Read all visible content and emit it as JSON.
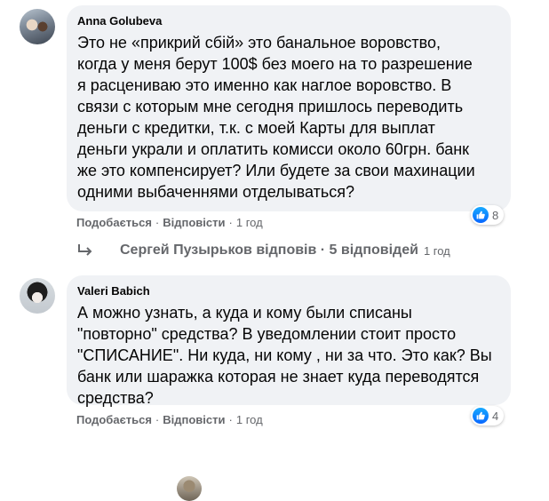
{
  "comments": [
    {
      "author": "Anna Golubeva",
      "text": "Это не «прикрий сбій» это банальное воровство,\nкогда у меня берут 100$ без моего на то разрешение\nя расцениваю это именно как наглое воровство. В\nсвязи с которым мне сегодня пришлось переводить\nденьги с кредитки, т.к. с моей Карты для выплат\nденьги украли и оплатить комисси около 60грн. банк\nже это компенсирует? Или будете за свои махинации\nодними выбаченнями отделываться?",
      "like_label": "Подобається",
      "reply_label": "Відповісти",
      "time": "1 год",
      "reaction_count": "8"
    },
    {
      "author": "Valeri Babich",
      "text": "А можно узнать, а куда и кому были списаны\n\"повторно\" средства? В уведомлении стоит просто\n\"СПИСАНИЕ\". Ни куда, ни кому , ни за что. Это как? Вы\nбанк или шаражка которая не знает куда переводятся\nсредства?",
      "like_label": "Подобається",
      "reply_label": "Відповісти",
      "time": "1 год",
      "reaction_count": "4"
    }
  ],
  "replies_row": {
    "text": "Сергей Пузырьков відповів · 5 відповідей",
    "time": "1 год"
  },
  "colors": {
    "bubble": "#f0f2f5",
    "meta": "#65676b",
    "like_blue": "#0866ff"
  }
}
